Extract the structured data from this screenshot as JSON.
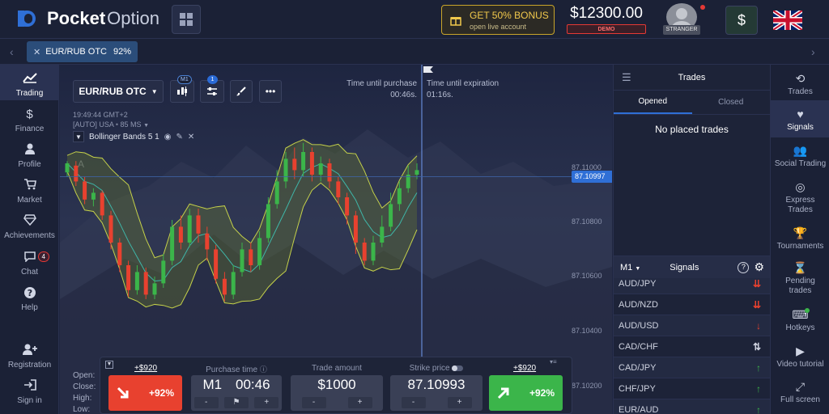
{
  "header": {
    "logo_bold": "Pocket",
    "logo_light": "Option",
    "bonus_title": "GET 50% BONUS",
    "bonus_sub": "open live account",
    "balance": "$12300.00",
    "account_type": "DEMO",
    "user_tag": "STRANGER",
    "dollar": "$",
    "colors": {
      "accent": "#2f6fd6",
      "buy": "#3bb54a",
      "sell": "#e8412f",
      "bonus": "#f2c94c"
    }
  },
  "asset_tab": {
    "pair": "EUR/RUB OTC",
    "payout": "92%"
  },
  "left_nav": [
    {
      "label": "Trading",
      "icon": "chart-line-icon"
    },
    {
      "label": "Finance",
      "icon": "dollar-icon"
    },
    {
      "label": "Profile",
      "icon": "user-icon"
    },
    {
      "label": "Market",
      "icon": "cart-icon"
    },
    {
      "label": "Achievements",
      "icon": "diamond-icon"
    },
    {
      "label": "Chat",
      "icon": "chat-icon",
      "badge": "4"
    },
    {
      "label": "Help",
      "icon": "question-icon"
    },
    {
      "label": "Registration",
      "icon": "user-plus-icon"
    },
    {
      "label": "Sign in",
      "icon": "sign-in-icon"
    }
  ],
  "chart": {
    "pair": "EUR/RUB OTC",
    "timeframe_badge": "M1",
    "settings_badge": "1",
    "time": "19:49:44 GMT+2",
    "feed": "[AUTO] USA",
    "ping": "85 MS",
    "indicator": "Bollinger Bands 5 1",
    "drawing_label": "A",
    "purchase_label": "Time until purchase",
    "purchase_value": "00:46s.",
    "expiration_label": "Time until expiration",
    "expiration_value": "01:16s.",
    "current_price": "87.10997",
    "price_labels": [
      "87.11000",
      "87.10800",
      "87.10600",
      "87.10400",
      "87.10200"
    ],
    "ohlc": [
      "Open:",
      "Close:",
      "High:",
      "Low:"
    ]
  },
  "chart_data": {
    "type": "candlestick",
    "y_ticks": [
      87.11,
      87.108,
      87.106,
      87.104,
      87.102
    ],
    "current_price": 87.10997,
    "candles": [
      [
        87.1099,
        87.1103,
        87.1104,
        87.1097
      ],
      [
        87.1102,
        87.1095,
        87.1104,
        87.1093
      ],
      [
        87.1095,
        87.1087,
        87.1097,
        87.1085
      ],
      [
        87.1087,
        87.109,
        87.1092,
        87.1084
      ],
      [
        87.109,
        87.108,
        87.1091,
        87.1078
      ],
      [
        87.108,
        87.1068,
        87.1082,
        87.1065
      ],
      [
        87.1068,
        87.1058,
        87.107,
        87.1055
      ],
      [
        87.1058,
        87.1047,
        87.106,
        87.1044
      ],
      [
        87.1047,
        87.1055,
        87.1058,
        87.1045
      ],
      [
        87.1055,
        87.1045,
        87.1057,
        87.1043
      ],
      [
        87.1045,
        87.105,
        87.1053,
        87.1043
      ],
      [
        87.105,
        87.106,
        87.1063,
        87.1048
      ],
      [
        87.106,
        87.1075,
        87.1078,
        87.1058
      ],
      [
        87.1075,
        87.1068,
        87.108,
        87.1065
      ],
      [
        87.1068,
        87.108,
        87.1083,
        87.1066
      ],
      [
        87.108,
        87.1072,
        87.1083,
        87.1068
      ],
      [
        87.1072,
        87.1065,
        87.1075,
        87.106
      ],
      [
        87.1065,
        87.1052,
        87.1067,
        87.105
      ],
      [
        87.1052,
        87.1045,
        87.1055,
        87.1042
      ],
      [
        87.1045,
        87.1055,
        87.1058,
        87.1043
      ],
      [
        87.1055,
        87.1065,
        87.1068,
        87.1053
      ],
      [
        87.1065,
        87.1058,
        87.1068,
        87.1055
      ],
      [
        87.1058,
        87.107,
        87.1073,
        87.1056
      ],
      [
        87.107,
        87.1085,
        87.1088,
        87.1068
      ],
      [
        87.1085,
        87.1095,
        87.11,
        87.1083
      ],
      [
        87.1095,
        87.1105,
        87.1108,
        87.1092
      ],
      [
        87.1105,
        87.11,
        87.111,
        87.1096
      ],
      [
        87.11,
        87.1108,
        87.1112,
        87.1097
      ],
      [
        87.1108,
        87.1098,
        87.111,
        87.1095
      ],
      [
        87.1098,
        87.1103,
        87.1106,
        87.1095
      ],
      [
        87.1103,
        87.1095,
        87.1105,
        87.1092
      ],
      [
        87.1095,
        87.1088,
        87.1097,
        87.1085
      ],
      [
        87.1088,
        87.108,
        87.109,
        87.1076
      ],
      [
        87.108,
        87.1068,
        87.1082,
        87.1063
      ],
      [
        87.1068,
        87.106,
        87.107,
        87.1058
      ],
      [
        87.106,
        87.1068,
        87.1071,
        87.1058
      ],
      [
        87.1068,
        87.1075,
        87.108,
        87.1066
      ],
      [
        87.1075,
        87.1085,
        87.109,
        87.1073
      ],
      [
        87.1085,
        87.1092,
        87.1095,
        87.1082
      ],
      [
        87.1092,
        87.1098,
        87.1102,
        87.109
      ],
      [
        87.1098,
        87.11,
        87.1103,
        87.1096
      ]
    ]
  },
  "trade_panel": {
    "sell_payout": "+$920",
    "sell_percent": "+92%",
    "purchase_time_label": "Purchase time",
    "timeframe": "M1",
    "purchase_time": "00:46",
    "trade_amount_label": "Trade amount",
    "trade_amount": "$1000",
    "strike_label": "Strike price",
    "strike_price": "87.10993",
    "buy_payout": "+$920",
    "buy_percent": "+92%",
    "minus": "-",
    "plus": "+"
  },
  "trades": {
    "title": "Trades",
    "tab_opened": "Opened",
    "tab_closed": "Closed",
    "empty": "No placed trades",
    "signals_title": "Signals",
    "signals_tf": "M1",
    "signals": [
      {
        "pair": "AUD/JPY",
        "dir": "down2"
      },
      {
        "pair": "AUD/NZD",
        "dir": "down2"
      },
      {
        "pair": "AUD/USD",
        "dir": "down"
      },
      {
        "pair": "CAD/CHF",
        "dir": "mixed"
      },
      {
        "pair": "CAD/JPY",
        "dir": "up"
      },
      {
        "pair": "CHF/JPY",
        "dir": "up"
      },
      {
        "pair": "EUR/AUD",
        "dir": "up"
      }
    ]
  },
  "right_nav": [
    {
      "label": "Trades",
      "icon": "history-icon"
    },
    {
      "label": "Signals",
      "icon": "heartbeat-icon"
    },
    {
      "label": "Social Trading",
      "icon": "users-icon"
    },
    {
      "label": "Express Trades",
      "icon": "target-icon"
    },
    {
      "label": "Tournaments",
      "icon": "trophy-icon"
    },
    {
      "label": "Pending trades",
      "icon": "hourglass-icon"
    },
    {
      "label": "Hotkeys",
      "icon": "keyboard-icon"
    },
    {
      "label": "Video tutorial",
      "icon": "video-icon"
    },
    {
      "label": "Full screen",
      "icon": "fullscreen-icon"
    }
  ]
}
